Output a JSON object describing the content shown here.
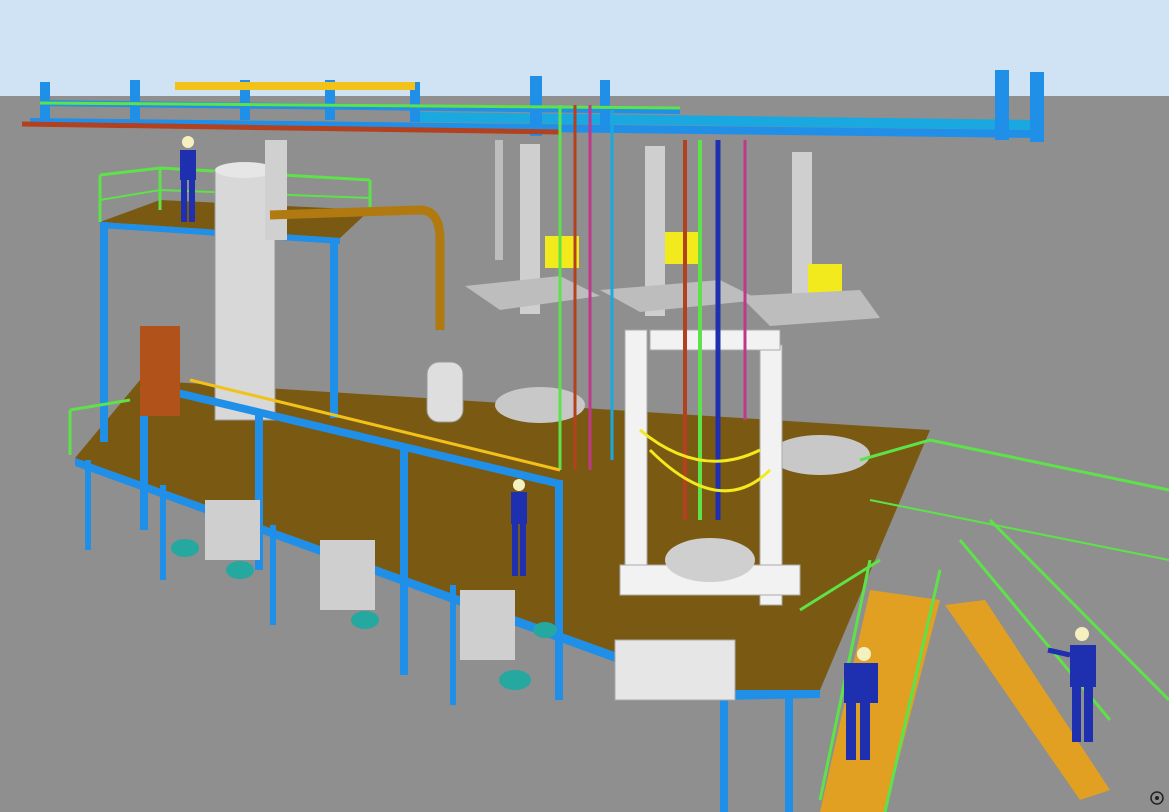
{
  "scene": {
    "colors": {
      "sky": "#cfe3f4",
      "ground": "#8f8f8f",
      "deck": "#7a5a12",
      "steel_blue": "#1f8fe8",
      "rail_green": "#5ee24a",
      "vessel": "#d8d8d8",
      "pipe_orange": "#c58a1a",
      "pipe_red": "#b3401e",
      "pump_teal": "#24a8a0",
      "motor_yellow": "#f2ea1c",
      "worker_blue": "#1e2fb0",
      "hardhat": "#f4f0c0",
      "door": "#b0521a"
    },
    "workers": [
      {
        "name": "worker-top-left"
      },
      {
        "name": "worker-center"
      },
      {
        "name": "worker-stairs"
      },
      {
        "name": "worker-right"
      }
    ]
  }
}
